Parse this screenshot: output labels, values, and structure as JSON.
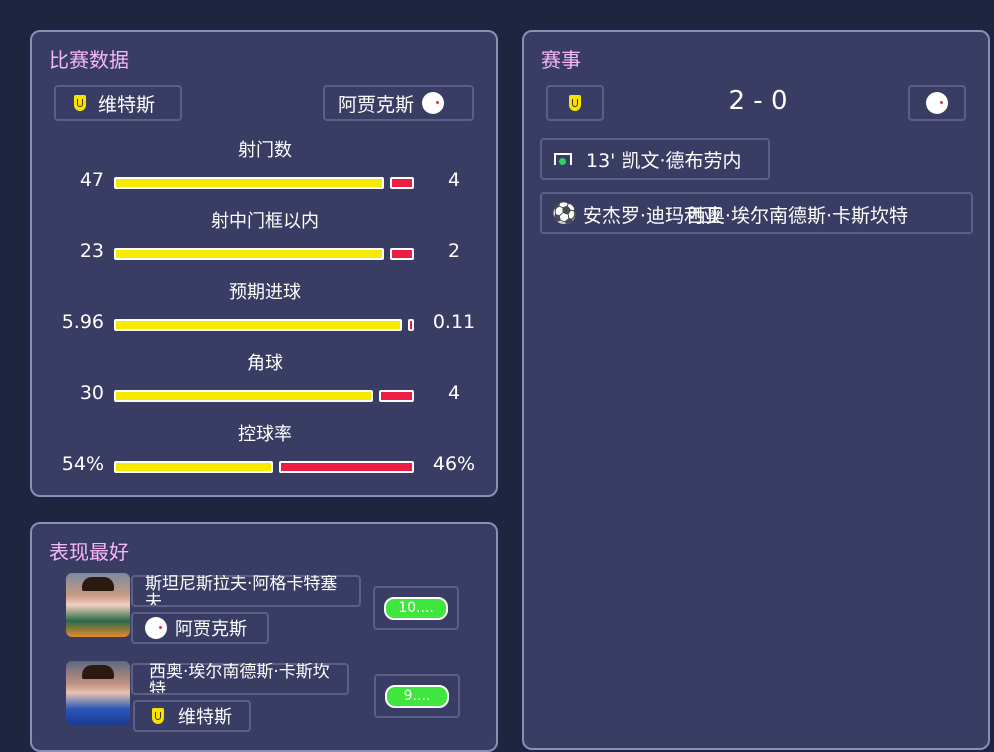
{
  "match_stats": {
    "title": "比赛数据",
    "home_team": "维特斯",
    "away_team": "阿贾克斯",
    "stats": [
      {
        "label": "射门数",
        "home": "47",
        "away": "4",
        "home_frac": 0.92,
        "away_frac": 0.08
      },
      {
        "label": "射中门框以内",
        "home": "23",
        "away": "2",
        "home_frac": 0.92,
        "away_frac": 0.08
      },
      {
        "label": "预期进球",
        "home": "5.96",
        "away": "0.11",
        "home_frac": 0.98,
        "away_frac": 0.02
      },
      {
        "label": "角球",
        "home": "30",
        "away": "4",
        "home_frac": 0.88,
        "away_frac": 0.12
      },
      {
        "label": "控球率",
        "home": "54%",
        "away": "46%",
        "home_frac": 0.54,
        "away_frac": 0.46
      }
    ]
  },
  "events": {
    "title": "赛事",
    "score": "2 - 0",
    "items": [
      {
        "icon": "goal-net-icon",
        "text": "13' 凯文·德布劳内"
      },
      {
        "icon": "soccer-ball-icon",
        "text": "安杰罗·迪玛利亚",
        "text2": "西奥·埃尔南德斯·卡斯坎特"
      }
    ]
  },
  "best_performers": {
    "title": "表现最好",
    "players": [
      {
        "name": "斯坦尼斯拉夫·阿格卡特塞夫",
        "team": "阿贾克斯",
        "rating": "10...."
      },
      {
        "name": "西奥·埃尔南德斯·卡斯坎特",
        "team": "维特斯",
        "rating": "9...."
      }
    ]
  },
  "colors": {
    "home_bar": "#f5ea00",
    "away_bar": "#ec1e44",
    "rating": "#3ee63e",
    "title": "#f6b8f8"
  }
}
